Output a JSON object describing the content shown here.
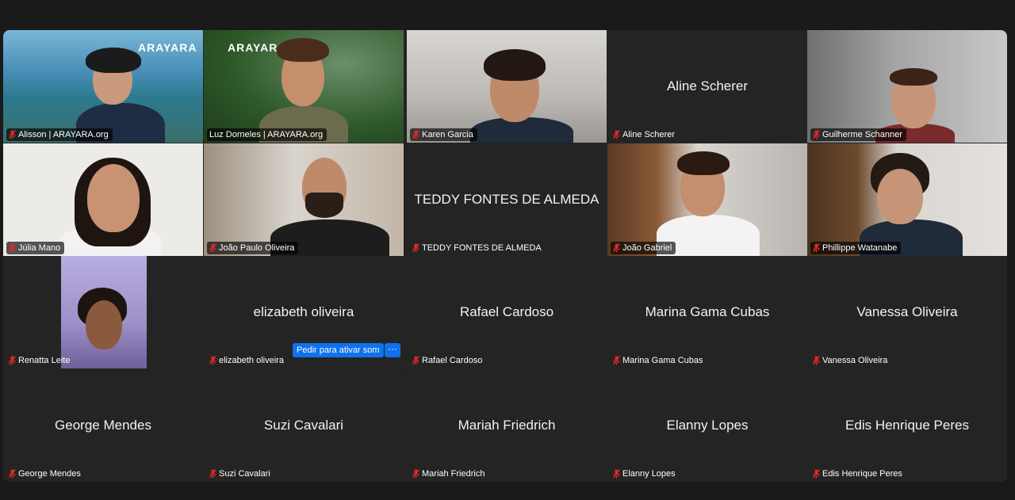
{
  "participants": [
    {
      "name": "Alisson | ARAYARA.org",
      "logo": "ARAYARA.org"
    },
    {
      "name": "Luz Dorneles | ARAYARA.org",
      "logo": "ARAYARA.org"
    },
    {
      "name": "Karen Garcia"
    },
    {
      "name": "Aline Scherer",
      "display": "Aline Scherer"
    },
    {
      "name": "Guilherme Schanner"
    },
    {
      "name": "Júlia Mano"
    },
    {
      "name": "João Paulo Oliveira"
    },
    {
      "name": "TEDDY FONTES DE ALMEDA",
      "display": "TEDDY FONTES DE ALMEDA"
    },
    {
      "name": "João Gabriel"
    },
    {
      "name": "Phillippe Watanabe"
    },
    {
      "name": "Renatta Leite"
    },
    {
      "name": "elizabeth oliveira",
      "display": "elizabeth oliveira"
    },
    {
      "name": "Rafael Cardoso",
      "display": "Rafael Cardoso"
    },
    {
      "name": "Marina Gama Cubas",
      "display": "Marina Gama Cubas"
    },
    {
      "name": "Vanessa Oliveira",
      "display": "Vanessa Oliveira"
    },
    {
      "name": "George Mendes",
      "display": "George Mendes"
    },
    {
      "name": "Suzi Cavalari",
      "display": "Suzi Cavalari"
    },
    {
      "name": "Mariah Friedrich",
      "display": "Mariah Friedrich"
    },
    {
      "name": "Elanny Lopes",
      "display": "Elanny Lopes"
    },
    {
      "name": "Edis Henrique Peres",
      "display": "Edis Henrique Peres"
    }
  ],
  "actions": {
    "ask_unmute_label": "Pedir para ativar som",
    "more_label": "···"
  },
  "colors": {
    "active_speaker": "#2bb14a",
    "muted_icon": "#e02828",
    "button": "#0e72ed"
  }
}
